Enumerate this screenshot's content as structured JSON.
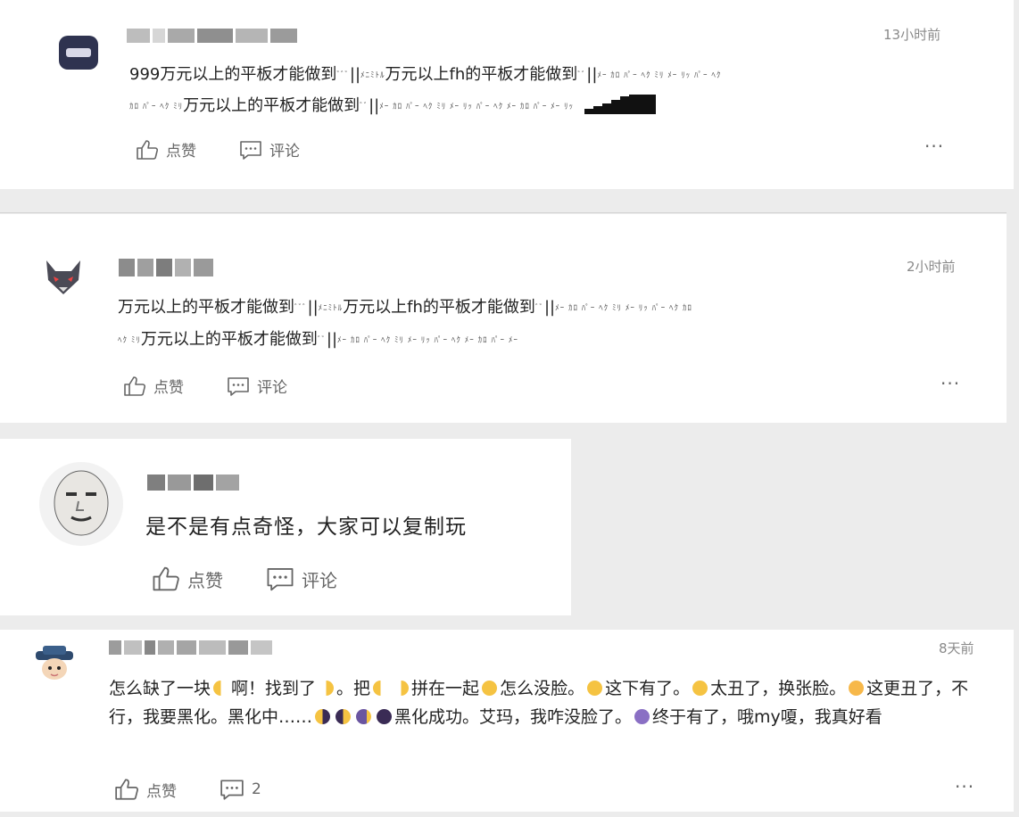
{
  "comments": [
    {
      "time": "13小时前",
      "text_line1_a": "999万元以上的平板才能做到",
      "text_line1_b": "||",
      "text_line1_c": "万元以上fh的平板才能做到",
      "text_line1_d": "||",
      "text_line2_a": "万元以上的平板才能做到",
      "text_line2_b": "||",
      "like_label": "点赞",
      "comment_label": "评论",
      "more_label": "···"
    },
    {
      "time": "2小时前",
      "text_line1_a": "万元以上的平板才能做到",
      "text_line1_b": "||",
      "text_line1_c": "万元以上fh的平板才能做到",
      "text_line1_d": "||",
      "text_line2_a": "万元以上的平板才能做到",
      "text_line2_b": "||",
      "like_label": "点赞",
      "comment_label": "评论",
      "more_label": "···"
    },
    {
      "text": "是不是有点奇怪，大家可以复制玩",
      "like_label": "点赞",
      "comment_label": "评论"
    },
    {
      "time": "8天前",
      "seg1": "怎么缺了一块",
      "seg2": "啊！找到了",
      "seg3": "。把",
      "seg4": "拼在一起",
      "seg5": "怎么没脸。",
      "seg6": "这下有了。",
      "seg7": "太丑了，换张脸。",
      "seg8": "这更丑了，不行，我要黑化。黑化中……",
      "seg9": "黑化成功。艾玛，我咋没脸了。",
      "seg10": "终于有了，哦my嗄，我真好看",
      "like_label": "点赞",
      "comment_count": "2",
      "more_label": "···"
    }
  ]
}
